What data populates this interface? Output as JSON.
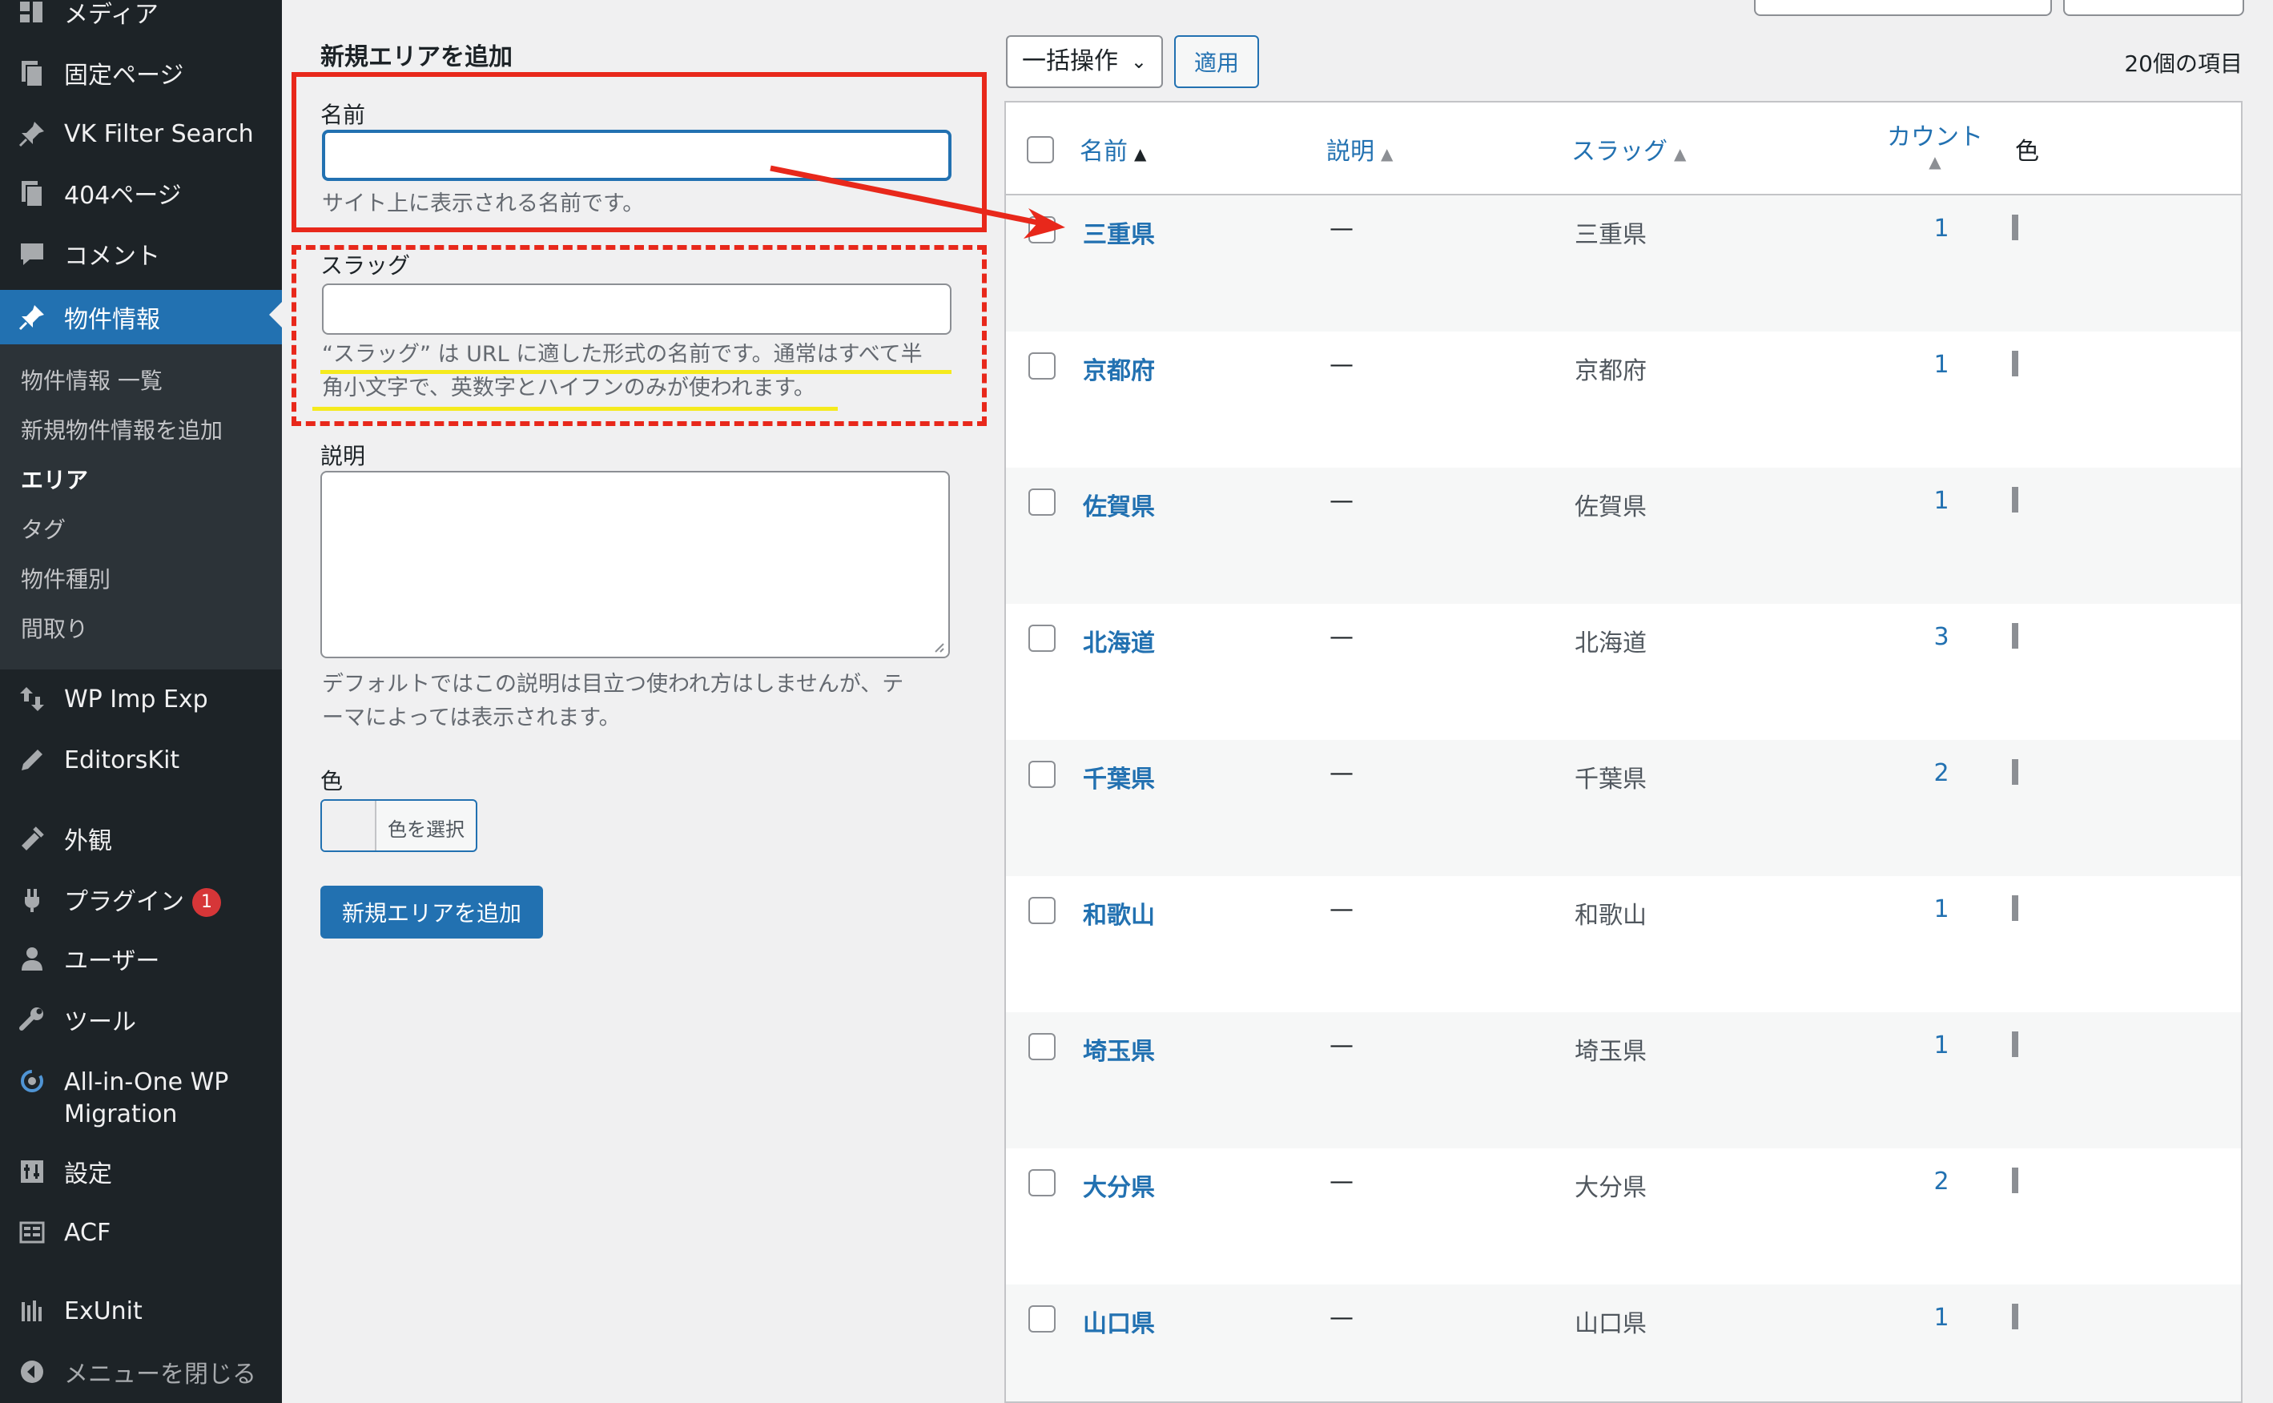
{
  "sidebar": {
    "items": [
      {
        "label": "メディア",
        "icon": "media-icon"
      },
      {
        "label": "固定ページ",
        "icon": "page-icon"
      },
      {
        "label": "VK Filter Search",
        "icon": "pin-icon"
      },
      {
        "label": "404ページ",
        "icon": "page-icon"
      },
      {
        "label": "コメント",
        "icon": "comment-icon"
      },
      {
        "label": "物件情報",
        "icon": "pin-icon"
      }
    ],
    "submenu": [
      "物件情報 一覧",
      "新規物件情報を追加",
      "エリア",
      "タグ",
      "物件種別",
      "間取り"
    ],
    "items_bottom": [
      {
        "label": "WP Imp Exp",
        "icon": "import-export-icon"
      },
      {
        "label": "EditorsKit",
        "icon": "edit-icon"
      },
      {
        "label": "外観",
        "icon": "appearance-icon"
      },
      {
        "label": "プラグイン",
        "icon": "plugin-icon",
        "badge": "1"
      },
      {
        "label": "ユーザー",
        "icon": "user-icon"
      },
      {
        "label": "ツール",
        "icon": "wrench-icon"
      },
      {
        "label": "All-in-One WP",
        "label2": "Migration",
        "icon": "migration-icon"
      },
      {
        "label": "設定",
        "icon": "settings-icon"
      },
      {
        "label": "ACF",
        "icon": "acf-icon"
      },
      {
        "label": "ExUnit",
        "icon": "exunit-icon"
      },
      {
        "label": "メニューを閉じる",
        "icon": "collapse-icon"
      }
    ]
  },
  "form": {
    "heading": "新規エリアを追加",
    "name_label": "名前",
    "name_help": "サイト上に表示される名前です。",
    "slug_label": "スラッグ",
    "slug_help_line1": "“スラッグ” は URL に適した形式の名前です。通常はすべて半",
    "slug_help_line2": "角小文字で、英数字とハイフンのみが使われます。",
    "desc_label": "説明",
    "desc_help_line1": "デフォルトではこの説明は目立つ使われ方はしませんが、テ",
    "desc_help_line2": "ーマによっては表示されます。",
    "color_label": "色",
    "color_button": "色を選択",
    "submit": "新規エリアを追加"
  },
  "list": {
    "bulk_action": "一括操作",
    "apply": "適用",
    "count_text": "20個の項目",
    "columns": {
      "name": "名前",
      "description": "説明",
      "slug": "スラッグ",
      "count": "カウント",
      "color": "色"
    },
    "rows": [
      {
        "name": "三重県",
        "description": "—",
        "slug": "三重県",
        "count": "1"
      },
      {
        "name": "京都府",
        "description": "—",
        "slug": "京都府",
        "count": "1"
      },
      {
        "name": "佐賀県",
        "description": "—",
        "slug": "佐賀県",
        "count": "1"
      },
      {
        "name": "北海道",
        "description": "—",
        "slug": "北海道",
        "count": "3"
      },
      {
        "name": "千葉県",
        "description": "—",
        "slug": "千葉県",
        "count": "2"
      },
      {
        "name": "和歌山",
        "description": "—",
        "slug": "和歌山",
        "count": "1"
      },
      {
        "name": "埼玉県",
        "description": "—",
        "slug": "埼玉県",
        "count": "1"
      },
      {
        "name": "大分県",
        "description": "—",
        "slug": "大分県",
        "count": "2"
      },
      {
        "name": "山口県",
        "description": "—",
        "slug": "山口県",
        "count": "1"
      }
    ]
  },
  "colors": {
    "accent": "#2271b1",
    "sidebar_bg": "#1d2327",
    "annotation_red": "#e8281b",
    "highlight_yellow": "#f5ea1d"
  }
}
